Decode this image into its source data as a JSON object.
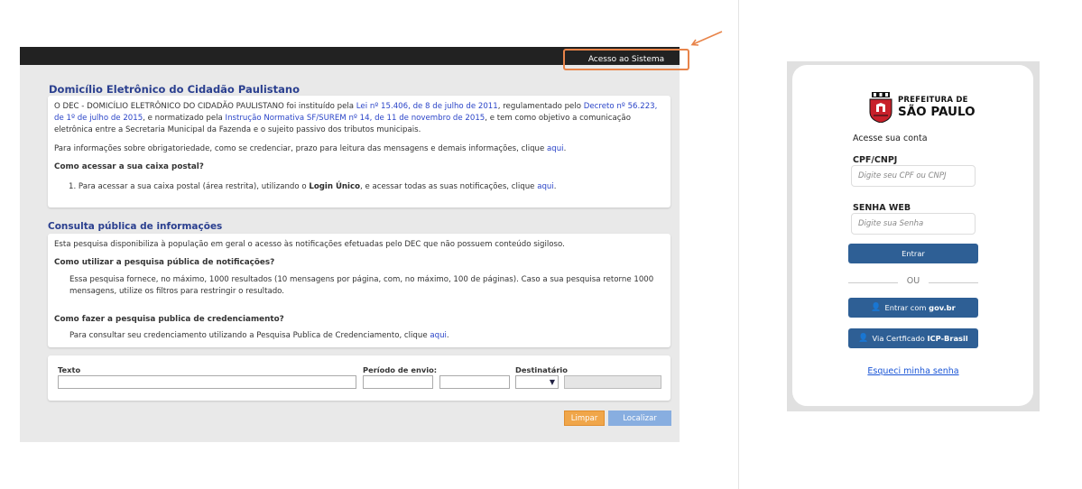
{
  "left": {
    "topbar": {
      "access_button": "Acesso ao Sistema"
    },
    "intro": {
      "title": "Domicílio Eletrônico do Cidadão Paulistano",
      "p1_a": "O DEC - DOMICÍLIO ELETRÔNICO DO CIDADÃO PAULISTANO foi instituído pela ",
      "p1_link1": "Lei nº 15.406, de 8 de julho de 2011",
      "p1_b": ", regulamentado pelo ",
      "p1_link2a": "Decreto nº 56.223,",
      "p1_link2b": "de 1º de julho de 2015",
      "p1_c": ", e normatizado pela ",
      "p1_link3": "Instrução Normativa SF/SUREM nº 14, de 11 de novembro de 2015",
      "p1_d": ", e tem como objetivo a comunicação",
      "p1_e": "eletrônica entre a Secretaria Municipal da Fazenda e o sujeito passivo dos tributos municipais.",
      "p2": "Para informações sobre obrigatoriedade, como se credenciar, prazo para leitura das mensagens e demais informações, clique ",
      "p2_link": "aqui",
      "q_title": "Como acessar a sua caixa postal?",
      "li_a": "1. Para acessar a sua caixa postal (área restrita), utilizando o ",
      "li_bold": "Login Único",
      "li_b": ", e acessar todas as suas notificações, clique ",
      "li_link": "aqui"
    },
    "consulta": {
      "title": "Consulta pública de informações",
      "p1": "Esta pesquisa disponibiliza à população em geral o acesso às notificações efetuadas pelo DEC que não possuem conteúdo sigiloso.",
      "q1": "Como utilizar a pesquisa pública de notificações?",
      "a1_line1": "Essa pesquisa fornece, no máximo, 1000 resultados (10 mensagens por página, com, no máximo, 100 de páginas). Caso a sua pesquisa retorne 1000",
      "a1_line2": "mensagens, utilize os filtros para restringir o resultado.",
      "q2": "Como fazer a pesquisa publica de credenciamento?",
      "a2": "Para consultar seu credenciamento utilizando a Pesquisa Publica de Credenciamento, clique ",
      "a2_link": "aqui"
    },
    "filters": {
      "texto_label": "Texto",
      "periodo_label": "Período de envio:",
      "destinatario_label": "Destinatário"
    },
    "buttons": {
      "limpar": "Limpar",
      "localizar": "Localizar"
    }
  },
  "login": {
    "logo_line1": "PREFEITURA DE",
    "logo_line2": "SÃO PAULO",
    "heading": "Acesse sua conta",
    "cpf_label": "CPF/CNPJ",
    "cpf_placeholder": "Digite seu CPF ou CNPJ",
    "senha_label": "SENHA WEB",
    "senha_placeholder": "Digite sua Senha",
    "enter_button": "Entrar",
    "or_text": "OU",
    "govbr_prefix": "Entrar com ",
    "govbr_bold": "gov.br",
    "cert_prefix": "Via Certficado ",
    "cert_bold": "ICP-Brasil",
    "forgot": "Esqueci minha senha"
  },
  "colors": {
    "accent_blue": "#2e5f95",
    "heading_blue": "#2a3f8f",
    "link_blue": "#2b45c8",
    "highlight_orange": "#e8844a",
    "limpar_orange": "#f0a64a",
    "localizar_blue": "#88aee0"
  }
}
